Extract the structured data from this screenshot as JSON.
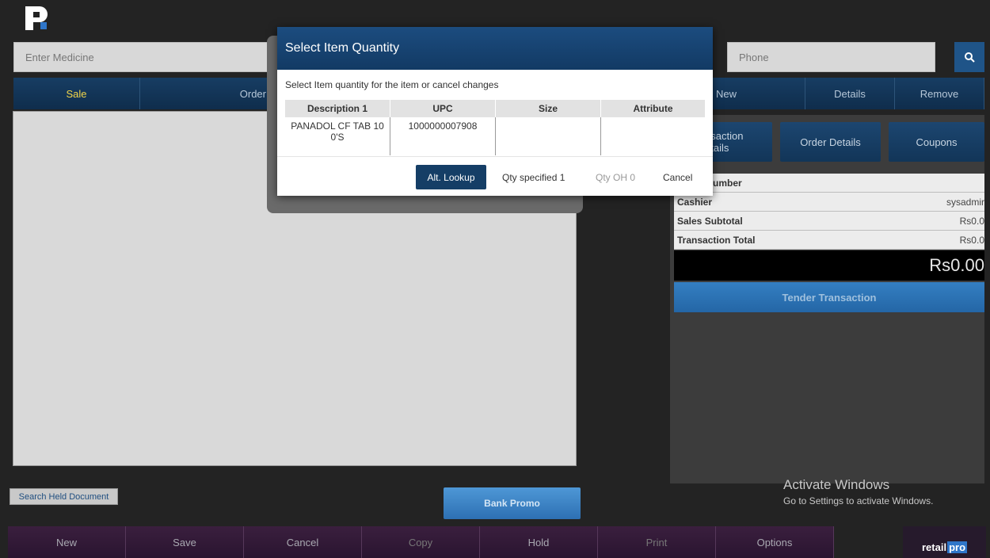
{
  "search": {
    "medicine_placeholder": "Enter Medicine",
    "phone_placeholder": "Phone"
  },
  "left_tabs": [
    "Sale",
    "Order"
  ],
  "right_tabs": [
    "New",
    "Details",
    "Remove"
  ],
  "right_buttons": {
    "transaction_details": "nsaction\netails",
    "order_details": "Order Details",
    "coupons": "Coupons"
  },
  "info_rows": [
    {
      "label": "umber",
      "value": ""
    },
    {
      "label": "Cashier",
      "value": "sysadmir"
    },
    {
      "label": "Sales Subtotal",
      "value": "Rs0.0"
    },
    {
      "label": "Transaction Total",
      "value": "Rs0.0"
    }
  ],
  "total_display": "Rs0.00",
  "tender_label": "Tender Transaction",
  "search_held_label": "Search Held Document",
  "bank_promo_label": "Bank Promo",
  "bottom_actions": [
    "New",
    "Save",
    "Cancel",
    "Copy",
    "Hold",
    "Print",
    "Options"
  ],
  "brand": {
    "retail": "retail",
    "pro": "pro"
  },
  "watermark": {
    "title": "Activate Windows",
    "subtitle": "Go to Settings to activate Windows."
  },
  "modal": {
    "title": "Select Item Quantity",
    "message": "Select Item quantity for the item or cancel changes",
    "columns": [
      "Description 1",
      "UPC",
      "Size",
      "Attribute"
    ],
    "rows": [
      [
        "PANADOL CF TAB 10 0'S",
        "1000000007908",
        "",
        ""
      ]
    ],
    "alt_lookup": "Alt. Lookup",
    "qty_specified": "Qty specified 1",
    "qty_oh": "Qty OH 0",
    "cancel": "Cancel"
  },
  "colors": {
    "accent": "#153e66",
    "active_tab": "#f2d54a"
  }
}
